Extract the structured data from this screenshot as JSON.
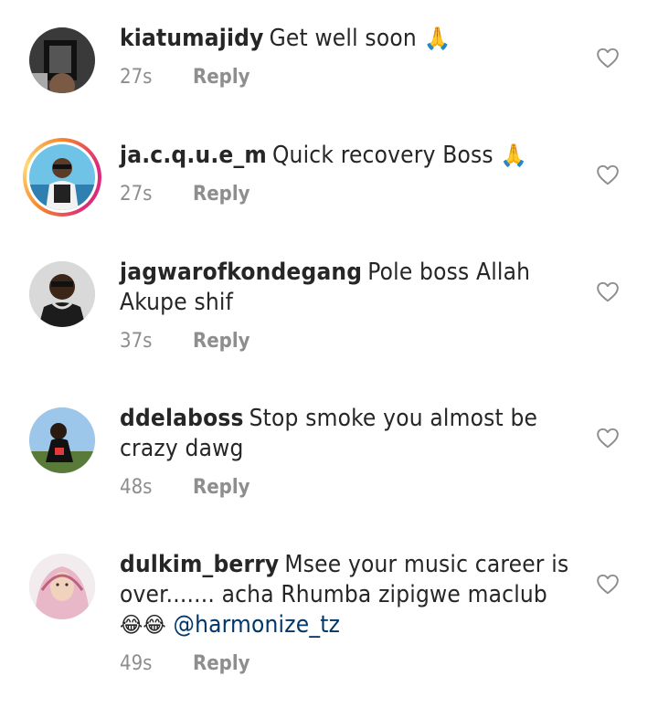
{
  "comments": [
    {
      "username": "kiatumajidy",
      "text": "Get well soon",
      "emoji": "🙏",
      "time": "27s",
      "reply_label": "Reply"
    },
    {
      "username": "ja.c.q.u.e_m",
      "text": "Quick recovery Boss",
      "emoji": "🙏",
      "time": "27s",
      "reply_label": "Reply"
    },
    {
      "username": "jagwarofkondegang",
      "text": "Pole boss Allah Akupe shif",
      "time": "37s",
      "reply_label": "Reply"
    },
    {
      "username": "ddelaboss",
      "text": "Stop smoke you almost be crazy dawg",
      "time": "48s",
      "reply_label": "Reply"
    },
    {
      "username": "dulkim_berry",
      "text": "Msee your music career is over....... acha Rhumba zipigwe maclub",
      "emoji": "😂😂",
      "mention": "@harmonize_tz",
      "time": "49s",
      "reply_label": "Reply"
    }
  ],
  "colors": {
    "text": "#262626",
    "meta": "#8e8e8e",
    "mention": "#00376b",
    "story_ring": [
      "#f58529",
      "#dd2a7b",
      "#feda77"
    ]
  },
  "icons": {
    "like": "heart-outline-icon"
  }
}
